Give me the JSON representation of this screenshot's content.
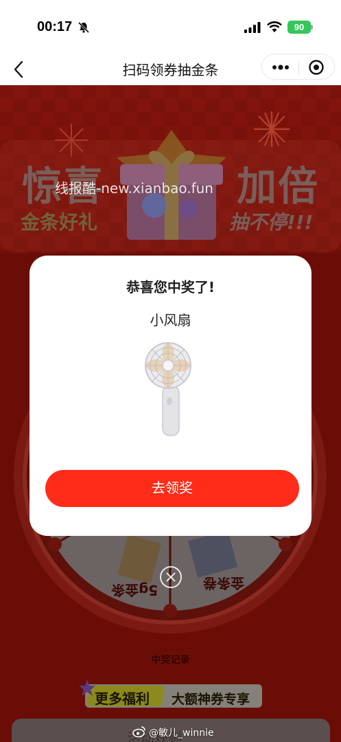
{
  "status_bar": {
    "time": "00:17",
    "battery": "90",
    "icons": [
      "bell-slash-icon",
      "signal-icon",
      "wifi-icon",
      "battery-icon"
    ]
  },
  "nav": {
    "title": "扫码领券抽金条",
    "back_icon": "chevron-left-icon",
    "more_icon": "more-dots-icon",
    "close_icon": "target-circle-icon"
  },
  "banner": {
    "headline_left": "惊喜",
    "headline_right": "加倍",
    "sub_left": "金条好礼",
    "sub_right": "抽不停!!!",
    "watermark": "线报酷-new.xianbao.fun"
  },
  "wheel": {
    "prizes": [
      "5g金条",
      "金条卷"
    ]
  },
  "links": {
    "records": "中奖记录"
  },
  "promo": {
    "left": "更多福利",
    "right": "大额神券专享"
  },
  "rules": {
    "label": "活动规则"
  },
  "modal": {
    "title": "恭喜您中奖了!",
    "prize": "小风扇",
    "claim_button": "去领奖",
    "close_icon": "close-circle-icon"
  },
  "attribution": {
    "text": "@敏儿_winnie"
  },
  "colors": {
    "accent": "#ff2c19",
    "page_bg": "#6b0d07",
    "battery": "#34c759"
  }
}
